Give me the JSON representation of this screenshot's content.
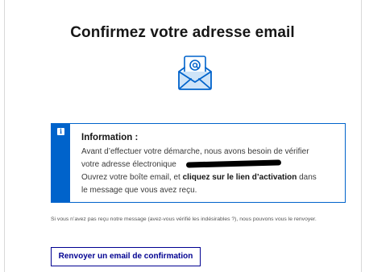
{
  "page": {
    "title": "Confirmez votre adresse email"
  },
  "icons": {
    "mail": "at-envelope-icon",
    "info": "info-icon"
  },
  "colors": {
    "accent_blue": "#0063cb",
    "button_blue": "#000091",
    "envelope_fill": "#cfe4f8"
  },
  "notice": {
    "info_glyph": "i",
    "title": "Information :",
    "line1": "Avant d’effectuer votre démarche, nous avons besoin de vérifier",
    "line2": "votre adresse électronique",
    "line3_prefix": "Ouvrez votre boîte email, et ",
    "line3_bold": "cliquez sur le lien d’activation",
    "line3_suffix": " dans",
    "line4": "le message que vous avez reçu."
  },
  "help": {
    "text": "Si vous n’avez pas reçu notre message (avez-vous vérifié les indésirables ?), nous pouvons vous le renvoyer."
  },
  "resend_button": {
    "label": "Renvoyer un email de confirmation"
  }
}
